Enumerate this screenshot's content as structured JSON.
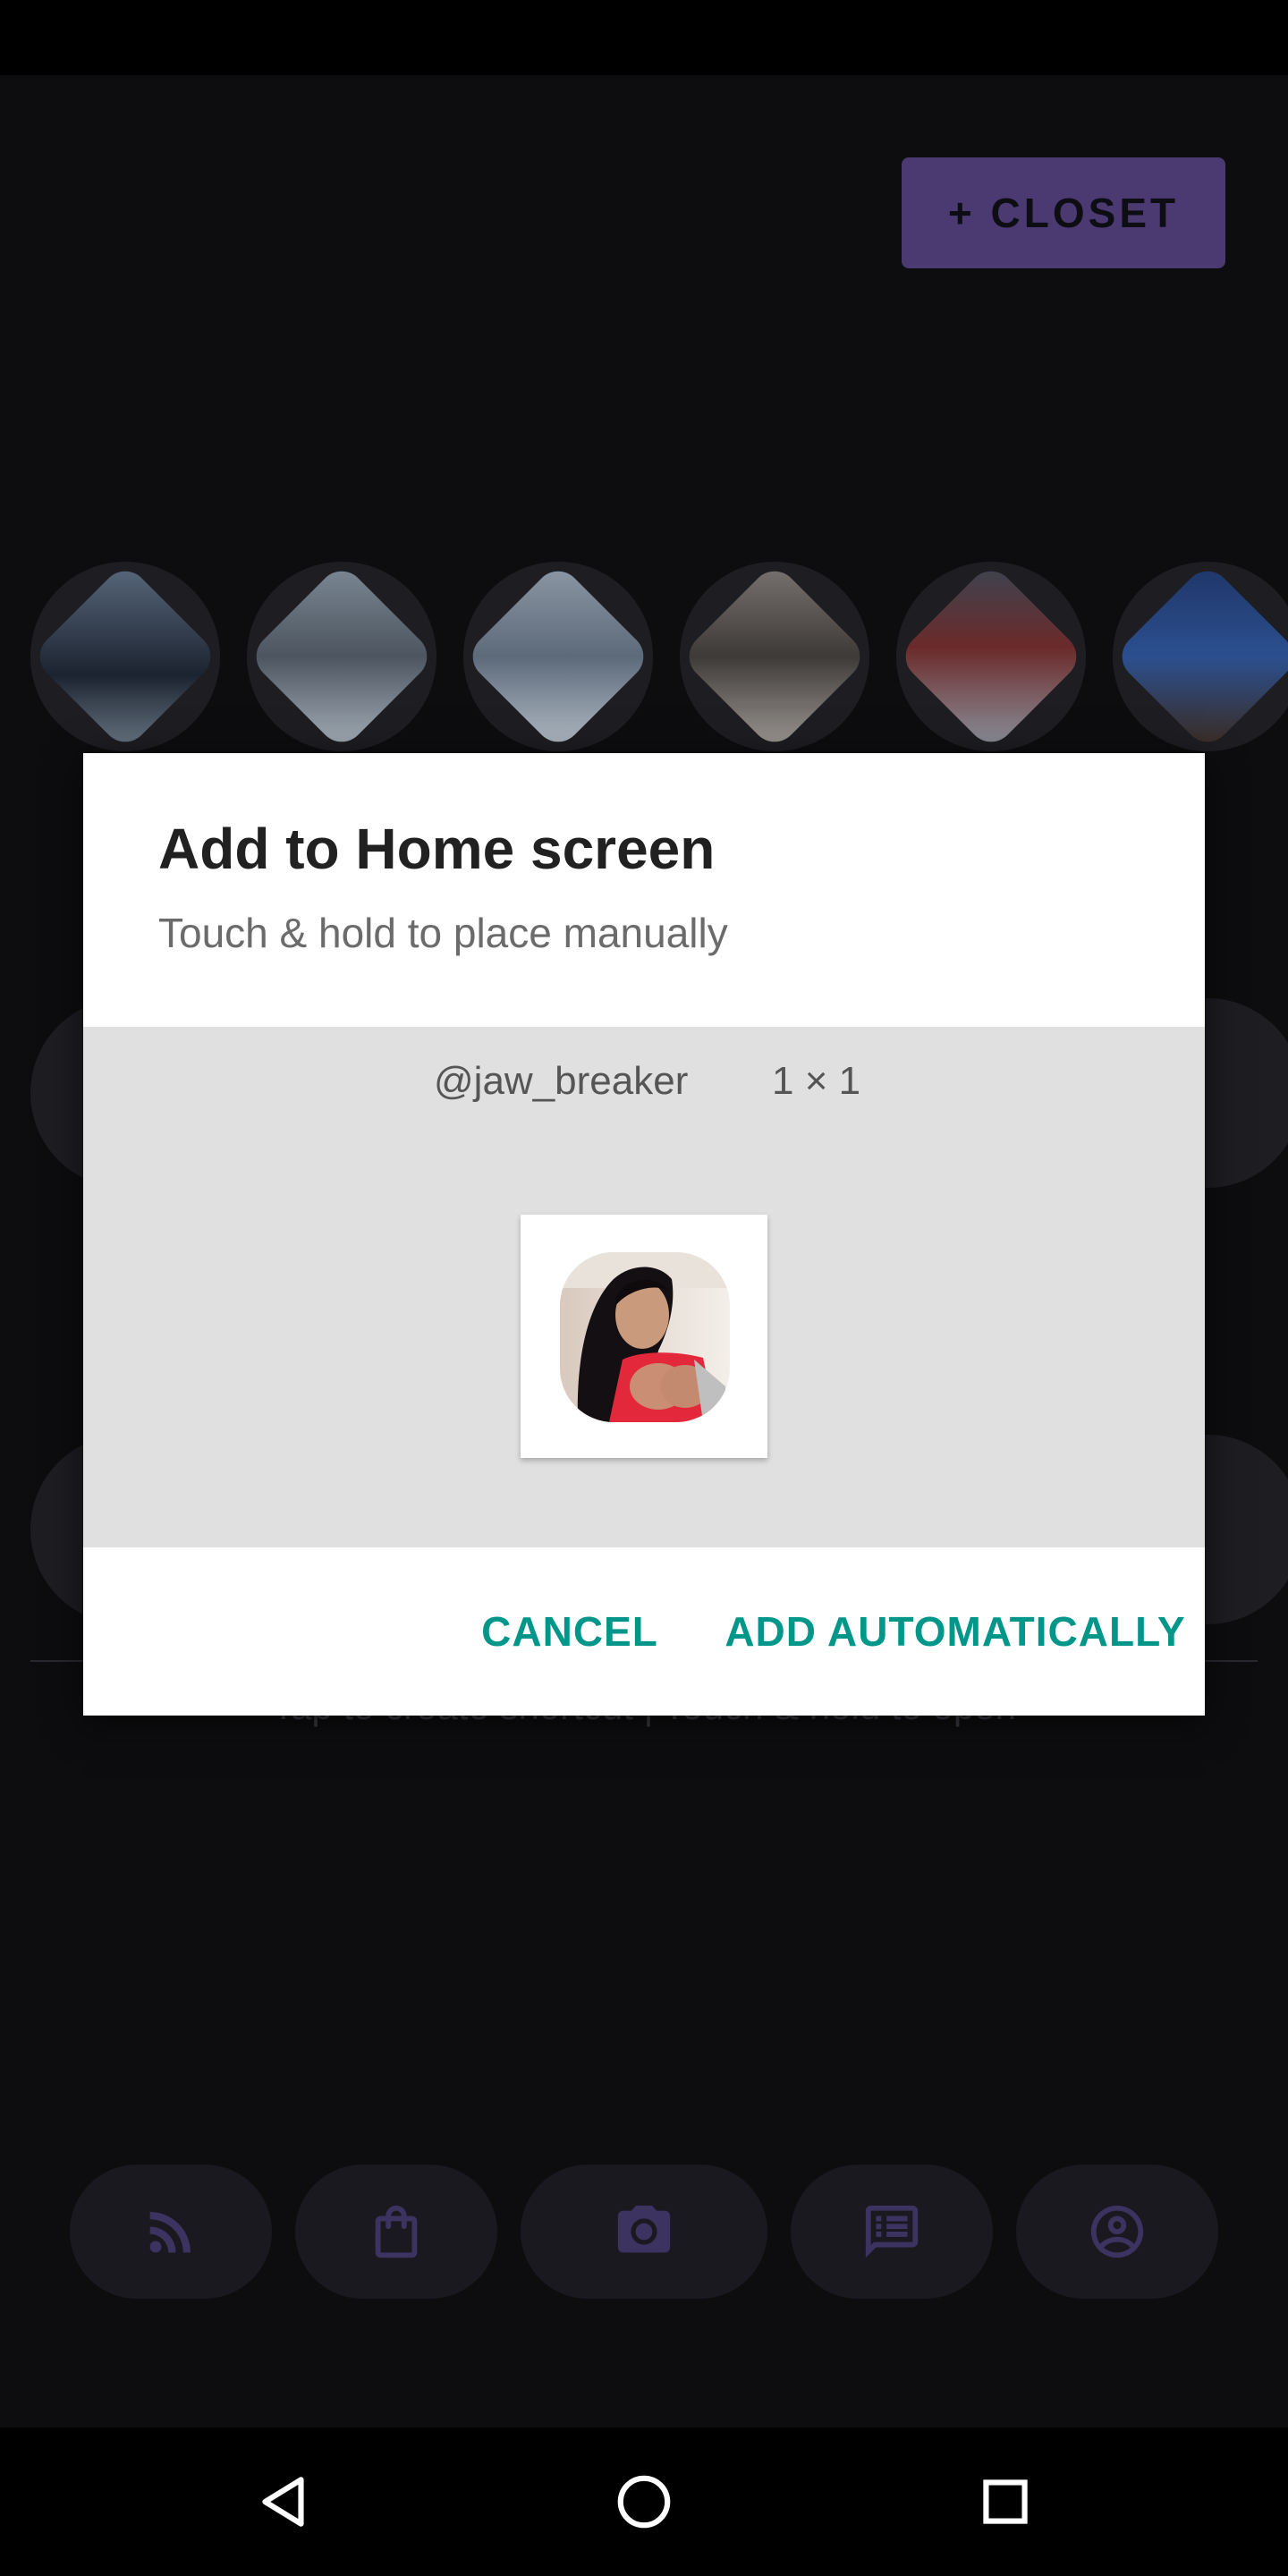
{
  "app": {
    "closet_button_label": "+ CLOSET",
    "hint_text": "Tap to create shortcut | Touch & hold to open",
    "accent_color": "#4b3a72",
    "tabs": [
      {
        "name": "feed",
        "icon": "rss-icon"
      },
      {
        "name": "shop",
        "icon": "shopping-bag-icon"
      },
      {
        "name": "camera",
        "icon": "camera-icon"
      },
      {
        "name": "messages",
        "icon": "message-list-icon"
      },
      {
        "name": "profile",
        "icon": "account-circle-icon"
      }
    ]
  },
  "dialog": {
    "title": "Add to Home screen",
    "subtitle": "Touch & hold to place manually",
    "widget_name": "@jaw_breaker",
    "widget_size": "1 × 1",
    "cancel_label": "CANCEL",
    "confirm_label": "ADD AUTOMATICALLY",
    "action_color": "#00968a"
  },
  "nav": {
    "back": "back-icon",
    "home": "home-icon",
    "recents": "recents-icon"
  }
}
